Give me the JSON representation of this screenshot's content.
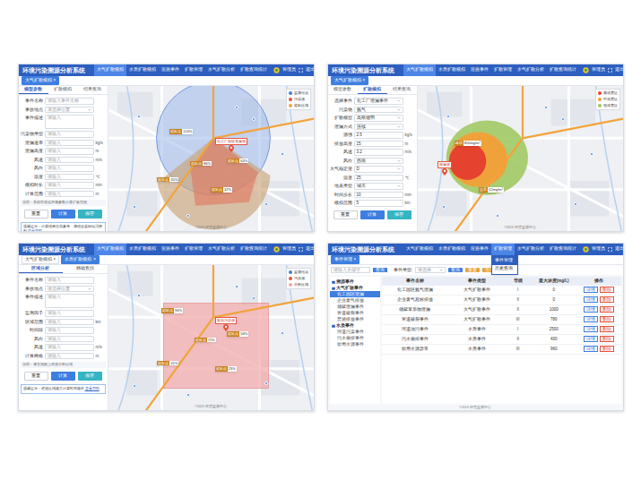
{
  "page": {
    "title": "环境污染溯源分析系统",
    "user": "管理员",
    "logout": "退出"
  },
  "screens": [
    {
      "kind": "map-form",
      "nav": [
        {
          "label": "大气扩散模拟",
          "selected": true
        },
        {
          "label": "水质扩散模拟",
          "selected": false
        },
        {
          "label": "应急事件",
          "selected": false
        },
        {
          "label": "扩散管理",
          "selected": false
        },
        {
          "label": "水气扩散分析",
          "selected": false
        },
        {
          "label": "扩散查询统计",
          "selected": false
        }
      ],
      "chips": [
        {
          "label": "大气扩散模拟",
          "close": "×",
          "selected": true
        }
      ],
      "subtabs": [
        {
          "label": "模型参数",
          "selected": true
        },
        {
          "label": "扩散模拟",
          "selected": false
        },
        {
          "label": "结果查询",
          "selected": false
        }
      ],
      "fields": [
        {
          "kind": "input",
          "label": "事件名称",
          "placeholder": "请输入事件名称",
          "value": "",
          "unit": ""
        },
        {
          "kind": "select",
          "label": "事故地点",
          "placeholder": "请选择位置",
          "value": "",
          "unit": ""
        },
        {
          "kind": "textarea",
          "label": "事件描述",
          "placeholder": "请输入",
          "value": "",
          "unit": ""
        },
        {
          "kind": "input",
          "label": "污染物类型",
          "placeholder": "请输入",
          "value": "",
          "unit": ""
        },
        {
          "kind": "input",
          "label": "泄漏速率",
          "placeholder": "请输入",
          "value": "",
          "unit": "kg/s"
        },
        {
          "kind": "input",
          "label": "泄漏高度",
          "placeholder": "请输入",
          "value": "",
          "unit": "m"
        },
        {
          "kind": "input",
          "label": "风速",
          "placeholder": "请输入",
          "value": "",
          "unit": "m/s"
        },
        {
          "kind": "input",
          "label": "风向",
          "placeholder": "请输入",
          "value": "",
          "unit": ""
        },
        {
          "kind": "input",
          "label": "温度",
          "placeholder": "请输入",
          "value": "",
          "unit": "℃"
        },
        {
          "kind": "input",
          "label": "模拟时长",
          "placeholder": "请输入",
          "value": "",
          "unit": "min"
        },
        {
          "kind": "input",
          "label": "计算范围",
          "placeholder": "请输入",
          "value": "",
          "unit": "m"
        }
      ],
      "note": "说明：系统将根据所填参数计算扩散范围",
      "buttons": [
        {
          "label": "重置",
          "color": "#ffffff"
        },
        {
          "label": "计算",
          "color": "#3d7ee0"
        },
        {
          "label": "保存",
          "color": "#35b4c4"
        }
      ],
      "tip": {
        "text": "温馨提示：计算结果仅供参考，请结合实际情况研判",
        "link": "查看帮助"
      },
      "map": {
        "overlay": "circle-sector",
        "source": "化工厂储罐泄漏源",
        "tags": [
          {
            "label": "超标点",
            "value": "120%"
          },
          {
            "label": "超标点",
            "value": "86%"
          },
          {
            "label": "超标点",
            "value": "64%"
          },
          {
            "label": "超标点",
            "value": "45%"
          },
          {
            "label": "超标点",
            "value": "32%"
          }
        ],
        "legend": [
          {
            "label": "监测站点",
            "color": "#3d7ee0"
          },
          {
            "label": "污染源",
            "color": "#e5533d"
          },
          {
            "label": "超标区域",
            "color": "#f0a33a"
          }
        ],
        "credit": "©2023 环境监测中心"
      }
    },
    {
      "kind": "map-form",
      "nav": [
        {
          "label": "大气扩散模拟",
          "selected": true
        },
        {
          "label": "水质扩散模拟",
          "selected": false
        },
        {
          "label": "应急事件",
          "selected": false
        },
        {
          "label": "扩散管理",
          "selected": false
        },
        {
          "label": "水气扩散分析",
          "selected": false
        },
        {
          "label": "扩散查询统计",
          "selected": false
        }
      ],
      "chips": [
        {
          "label": "大气扩散模拟",
          "close": "×",
          "selected": true
        }
      ],
      "subtabs": [
        {
          "label": "模型参数",
          "selected": false
        },
        {
          "label": "扩散模拟",
          "selected": true
        },
        {
          "label": "结果查询",
          "selected": false
        }
      ],
      "fields": [
        {
          "kind": "select",
          "label": "选择事件",
          "placeholder": "",
          "value": "化工厂泄漏事件",
          "unit": ""
        },
        {
          "kind": "select",
          "label": "污染物",
          "placeholder": "",
          "value": "氨气",
          "unit": ""
        },
        {
          "kind": "select",
          "label": "扩散模型",
          "placeholder": "",
          "value": "高斯烟羽",
          "unit": ""
        },
        {
          "kind": "select",
          "label": "泄漏方式",
          "placeholder": "",
          "value": "连续",
          "unit": ""
        },
        {
          "kind": "input",
          "label": "源强",
          "placeholder": "",
          "value": "2.5",
          "unit": "kg/s"
        },
        {
          "kind": "input",
          "label": "排放高度",
          "placeholder": "",
          "value": "15",
          "unit": "m"
        },
        {
          "kind": "input",
          "label": "风速",
          "placeholder": "",
          "value": "3.2",
          "unit": "m/s"
        },
        {
          "kind": "select",
          "label": "风向",
          "placeholder": "",
          "value": "西南",
          "unit": ""
        },
        {
          "kind": "select",
          "label": "大气稳定度",
          "placeholder": "",
          "value": "D",
          "unit": ""
        },
        {
          "kind": "input",
          "label": "温度",
          "placeholder": "",
          "value": "25",
          "unit": "℃"
        },
        {
          "kind": "select",
          "label": "地表类型",
          "placeholder": "",
          "value": "城市",
          "unit": ""
        },
        {
          "kind": "input",
          "label": "时间步长",
          "placeholder": "",
          "value": "10",
          "unit": "min"
        },
        {
          "kind": "input",
          "label": "模拟范围",
          "placeholder": "",
          "value": "5",
          "unit": "km"
        }
      ],
      "note": "",
      "buttons": [
        {
          "label": "重置",
          "color": "#ffffff"
        },
        {
          "label": "计算",
          "color": "#3d7ee0"
        },
        {
          "label": "保存",
          "color": "#35b4c4"
        }
      ],
      "tip": {
        "text": "",
        "link": ""
      },
      "map": {
        "overlay": "plume",
        "source": "泄漏源",
        "tags": [
          {
            "label": "峰值",
            "value": "850mg/m³"
          },
          {
            "label": "边界",
            "value": "12mg/m³"
          }
        ],
        "legend": [
          {
            "label": "高浓度区",
            "color": "#e5432f"
          },
          {
            "label": "中浓度区",
            "color": "#f0a23a"
          },
          {
            "label": "低浓度区",
            "color": "#9cc75a"
          }
        ],
        "credit": "©2023 环境监测中心"
      }
    },
    {
      "kind": "map-form",
      "nav": [
        {
          "label": "大气扩散模拟",
          "selected": true
        },
        {
          "label": "水质扩散模拟",
          "selected": false
        },
        {
          "label": "应急事件",
          "selected": false
        },
        {
          "label": "扩散管理",
          "selected": false
        },
        {
          "label": "水气扩散分析",
          "selected": false
        },
        {
          "label": "扩散查询统计",
          "selected": false
        }
      ],
      "chips": [
        {
          "label": "大气扩散模拟",
          "close": "×",
          "selected": false
        },
        {
          "label": "水质扩散模拟",
          "close": "×",
          "selected": true
        }
      ],
      "subtabs": [
        {
          "label": "区域分析",
          "selected": true
        },
        {
          "label": "精确查找",
          "selected": false
        }
      ],
      "fields": [
        {
          "kind": "input",
          "label": "事件名称",
          "placeholder": "请输入",
          "value": "",
          "unit": ""
        },
        {
          "kind": "select",
          "label": "事故地点",
          "placeholder": "请选择位置",
          "value": "",
          "unit": ""
        },
        {
          "kind": "textarea",
          "label": "事件描述",
          "placeholder": "请输入",
          "value": "",
          "unit": ""
        },
        {
          "kind": "input",
          "label": "监测因子",
          "placeholder": "请输入",
          "value": "",
          "unit": ""
        },
        {
          "kind": "input",
          "label": "区域范围",
          "placeholder": "请输入",
          "value": "",
          "unit": "km"
        },
        {
          "kind": "input",
          "label": "时间段",
          "placeholder": "请输入",
          "value": "",
          "unit": ""
        },
        {
          "kind": "input",
          "label": "风向",
          "placeholder": "请输入",
          "value": "",
          "unit": ""
        },
        {
          "kind": "input",
          "label": "风速",
          "placeholder": "请输入",
          "value": "",
          "unit": "m/s"
        },
        {
          "kind": "input",
          "label": "计算网格",
          "placeholder": "请输入",
          "value": "",
          "unit": "m"
        }
      ],
      "note": "说明：请在地图上框选分析区域",
      "buttons": [
        {
          "label": "重置",
          "color": "#ffffff"
        },
        {
          "label": "计算",
          "color": "#3d7ee0"
        },
        {
          "label": "保存",
          "color": "#35b4c4"
        }
      ],
      "tip": {
        "text": "温馨提示：框选区域越大计算时间越长",
        "link": "查看帮助"
      },
      "map": {
        "overlay": "rectangle",
        "source": "疑似污染源",
        "tags": [
          {
            "label": "超标点",
            "value": "96%"
          },
          {
            "label": "超标点",
            "value": "72%"
          },
          {
            "label": "超标点",
            "value": "58%"
          },
          {
            "label": "超标点",
            "value": "41%"
          },
          {
            "label": "超标点",
            "value": "23%"
          }
        ],
        "legend": [
          {
            "label": "监测站点",
            "color": "#3d7ee0"
          },
          {
            "label": "污染源",
            "color": "#e5533d"
          },
          {
            "label": "分析区域",
            "color": "#f2a7a7"
          }
        ],
        "credit": "©2023 环境监测中心"
      }
    },
    {
      "kind": "table",
      "nav": [
        {
          "label": "大气扩散模拟",
          "selected": false
        },
        {
          "label": "水质扩散模拟",
          "selected": false
        },
        {
          "label": "应急事件",
          "selected": false
        },
        {
          "label": "扩散管理",
          "selected": true
        },
        {
          "label": "水气扩散分析",
          "selected": false
        },
        {
          "label": "扩散查询统计",
          "selected": false
        }
      ],
      "menu": [
        {
          "label": "事件管理",
          "selected": true
        },
        {
          "label": "历史查询",
          "selected": false
        }
      ],
      "chips": [
        {
          "label": "事件管理",
          "close": "×",
          "selected": true
        }
      ],
      "filter": {
        "keyword_placeholder": "请输入关键字",
        "search": "查询",
        "type_label": "事件类型:",
        "type_value": "请选择",
        "actions": [
          {
            "label": "查询",
            "color": "#3d7ee0"
          },
          {
            "label": "重置",
            "color": "#e9a23b"
          },
          {
            "label": "导出",
            "color": "#e9a23b"
          },
          {
            "label": "新增",
            "color": "#35b4c4"
          }
        ]
      },
      "tree": [
        {
          "label": "溯源事件",
          "kind": "group",
          "expanded": true,
          "selected": false
        },
        {
          "label": "大气扩散事件",
          "kind": "group",
          "expanded": true,
          "selected": false
        },
        {
          "label": "化工园区泄漏",
          "kind": "leaf",
          "expanded": false,
          "selected": true
        },
        {
          "label": "企业废气排放",
          "kind": "leaf",
          "expanded": false,
          "selected": false
        },
        {
          "label": "储罐泄漏事件",
          "kind": "leaf",
          "expanded": false,
          "selected": false
        },
        {
          "label": "管道破裂事件",
          "kind": "leaf",
          "expanded": false,
          "selected": false
        },
        {
          "label": "焚烧排放事件",
          "kind": "leaf",
          "expanded": false,
          "selected": false
        },
        {
          "label": "水质事件",
          "kind": "group",
          "expanded": true,
          "selected": false
        },
        {
          "label": "河道污染事件",
          "kind": "leaf",
          "expanded": false,
          "selected": false
        },
        {
          "label": "污水偷排事件",
          "kind": "leaf",
          "expanded": false,
          "selected": false
        },
        {
          "label": "饮用水源事件",
          "kind": "leaf",
          "expanded": false,
          "selected": false
        }
      ],
      "table": {
        "columns": [
          "事件名称",
          "事件类型",
          "等级",
          "最大浓度(mg/L)",
          "操作"
        ],
        "rows": [
          [
            "化工园区氨气泄漏",
            "大气扩散事件",
            "I",
            "0"
          ],
          [
            "企业废气超标排放",
            "大气扩散事件",
            "II",
            "0"
          ],
          [
            "储罐苯系物泄漏",
            "大气扩散事件",
            "II",
            "1000"
          ],
          [
            "管道破裂事件",
            "大气扩散事件",
            "III",
            "780"
          ],
          [
            "河道油污事件",
            "水质事件",
            "I",
            "2500"
          ],
          [
            "污水偷排事件",
            "水质事件",
            "II",
            "400"
          ],
          [
            "饮用水源异常",
            "水质事件",
            "III",
            "960"
          ]
        ],
        "actions": [
          {
            "label": "详情",
            "color": "#3d7ee0"
          },
          {
            "label": "删除",
            "color": "#e5533d"
          }
        ]
      },
      "credit": "©2023 环境监测中心"
    }
  ]
}
